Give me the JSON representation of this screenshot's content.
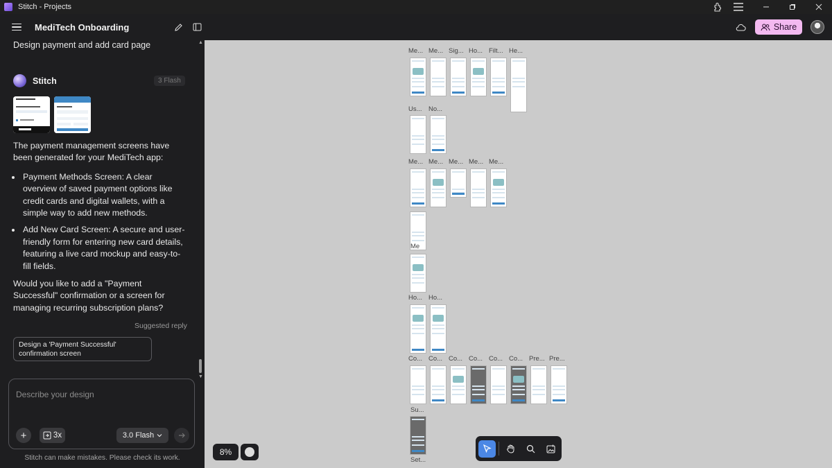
{
  "window": {
    "title": "Stitch - Projects",
    "icons": [
      "extensions-icon",
      "menu-icon"
    ],
    "controls": [
      "minimize-icon",
      "restore-icon",
      "close-icon"
    ]
  },
  "header": {
    "project_title": "MediTech Onboarding",
    "share_label": "Share"
  },
  "chat": {
    "user_prompt": "Design payment and add card page",
    "agent_name": "Stitch",
    "badge": "3 Flash",
    "intro": "The payment management screens have been generated for your MediTech app:",
    "bullets": [
      "Payment Methods Screen: A clear overview of saved payment options like credit cards and digital wallets, with a simple way to add new methods.",
      "Add New Card Screen: A secure and user-friendly form for entering new card details, featuring a live card mockup and easy-to-fill fields."
    ],
    "question": "Would you like to add a \"Payment Successful\" confirmation or a screen for managing recurring subscription plans?",
    "suggested_label": "Suggested reply",
    "suggestion": "Design a 'Payment Successful' confirmation screen"
  },
  "composer": {
    "placeholder": "Describe your design",
    "variants_label": "3x",
    "model_label": "3.0 Flash",
    "disclaimer": "Stitch can make mistakes. Please check its work."
  },
  "canvas": {
    "zoom": "8%",
    "labels": {
      "r1": [
        "Me...",
        "Me...",
        "Sig...",
        "Ho...",
        "Filt...",
        "He..."
      ],
      "r2": [
        "Us...",
        "No..."
      ],
      "r3": [
        "Me...",
        "Me...",
        "Me...",
        "Me...",
        "Me..."
      ],
      "r4": "Me",
      "r5": [
        "Ho...",
        "Ho..."
      ],
      "r6": [
        "Co...",
        "Co...",
        "Co...",
        "Co...",
        "Co...",
        "Co...",
        "Pre...",
        "Pre..."
      ],
      "r7": [
        "Su...",
        "Set..."
      ]
    }
  },
  "toolbar": {
    "tools": [
      "select-tool",
      "pan-tool",
      "zoom-tool",
      "add-image-tool"
    ],
    "active": "select-tool"
  },
  "colors": {
    "share_bg": "#f3b9f0",
    "active_tool": "#4b87e5",
    "canvas_bg": "#cbcbcb",
    "sidebar_bg": "#1e1e20"
  }
}
